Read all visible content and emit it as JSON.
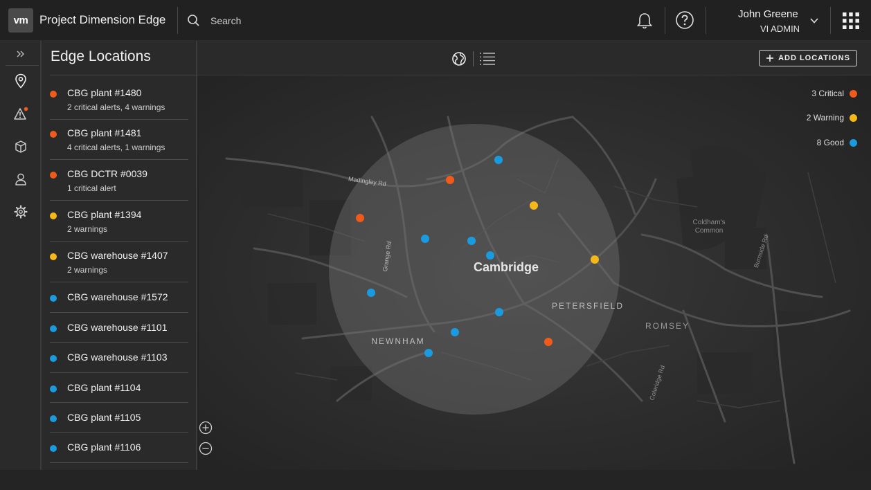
{
  "header": {
    "logo_text": "vm",
    "app_title": "Project Dimension Edge",
    "search_placeholder": "Search",
    "user_name": "John Greene",
    "user_role": "VI ADMIN",
    "icons": [
      "search-icon",
      "bell-icon",
      "help-icon",
      "chevron-down-icon",
      "apps-grid-icon"
    ]
  },
  "rail": {
    "icons": [
      "expand-icon",
      "location-pin-icon",
      "alert-icon",
      "box-icon",
      "user-icon",
      "gear-icon"
    ]
  },
  "panel": {
    "title": "Edge Locations",
    "locations": [
      {
        "name": "CBG plant #1480",
        "sub": "2 critical alerts, 4 warnings",
        "status": "critical"
      },
      {
        "name": "CBG plant #1481",
        "sub": "4 critical alerts, 1 warnings",
        "status": "critical"
      },
      {
        "name": "CBG DCTR #0039",
        "sub": "1 critical alert",
        "status": "critical"
      },
      {
        "name": "CBG plant #1394",
        "sub": "2 warnings",
        "status": "warning"
      },
      {
        "name": "CBG warehouse #1407",
        "sub": "2 warnings",
        "status": "warning"
      },
      {
        "name": "CBG warehouse #1572",
        "sub": "",
        "status": "good"
      },
      {
        "name": "CBG warehouse #1101",
        "sub": "",
        "status": "good"
      },
      {
        "name": "CBG warehouse #1103",
        "sub": "",
        "status": "good"
      },
      {
        "name": "CBG plant #1104",
        "sub": "",
        "status": "good"
      },
      {
        "name": "CBG plant #1105",
        "sub": "",
        "status": "good"
      },
      {
        "name": "CBG plant #1106",
        "sub": "",
        "status": "good"
      }
    ]
  },
  "toolbar": {
    "add_label": "ADD LOCATIONS",
    "view_icons": [
      "globe-view-icon",
      "list-view-icon"
    ]
  },
  "map": {
    "labels": {
      "city": "Cambridge",
      "petersfield": "PETERSFIELD",
      "romsey": "ROMSEY",
      "newnham": "NEWNHAM",
      "madingley": "Madingley Rd",
      "grange": "Grange Rd",
      "coldhams": "Coldham's",
      "common": "Common",
      "coleridge": "Coleridge Rd",
      "burnside": "Burnside Rd"
    },
    "legend": [
      {
        "label": "3 Critical",
        "status": "critical"
      },
      {
        "label": "2 Warning",
        "status": "warning"
      },
      {
        "label": "8 Good",
        "status": "good"
      }
    ]
  },
  "colors": {
    "critical": "#f05a1a",
    "warning": "#f5b818",
    "good": "#1a9be0",
    "background": "#222222"
  }
}
